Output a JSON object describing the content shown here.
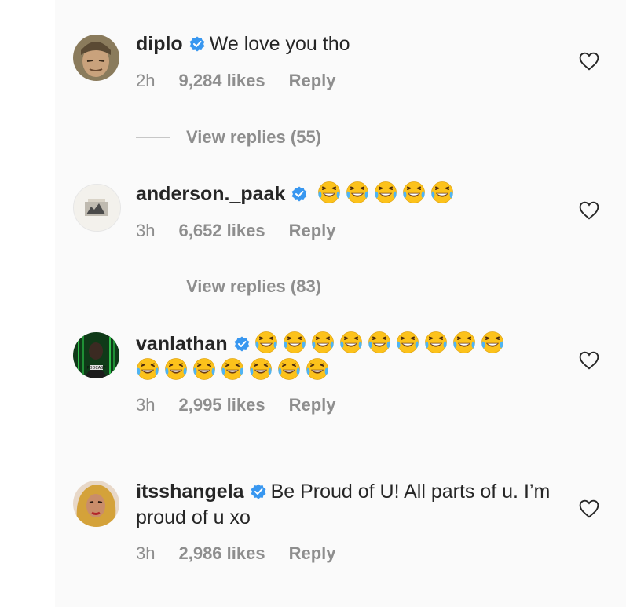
{
  "comments": [
    {
      "username": "diplo",
      "text": "We love you tho",
      "time": "2h",
      "likes": "9,284 likes",
      "reply": "Reply",
      "view_replies": "View replies (55)"
    },
    {
      "username": "anderson._paak",
      "emoji": "😂😂😂😂😂",
      "time": "3h",
      "likes": "6,652 likes",
      "reply": "Reply",
      "view_replies": "View replies (83)"
    },
    {
      "username": "vanlathan",
      "emoji": "😂😂😂😂😂😂😂😂😂😂😂😂😂😂😂😂",
      "time": "3h",
      "likes": "2,995 likes",
      "reply": "Reply",
      "avatar_label": "PODCAST"
    },
    {
      "username": "itsshangela",
      "text": "Be Proud of U! All parts of u. I’m proud of u xo",
      "time": "3h",
      "likes": "2,986 likes",
      "reply": "Reply"
    }
  ],
  "colors": {
    "verified": "#3897f0",
    "meta": "#8e8e8e",
    "panel_bg": "#fafafa"
  },
  "icons": [
    "verified-badge-icon",
    "heart-icon",
    "laughing-emoji-icon"
  ]
}
